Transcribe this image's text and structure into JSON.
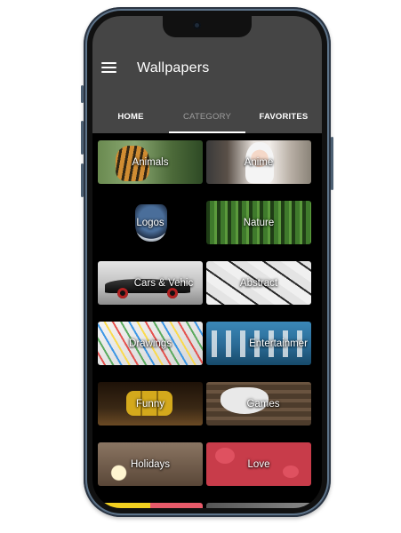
{
  "app": {
    "title": "Wallpapers"
  },
  "icons": {
    "menu": "menu-icon",
    "camera": "front-camera"
  },
  "tabs": [
    {
      "label": "HOME",
      "active": false
    },
    {
      "label": "CATEGORY",
      "active": true
    },
    {
      "label": "FAVORITES",
      "active": false
    }
  ],
  "categories": [
    {
      "label": "Animals",
      "bg": "#5d7a46"
    },
    {
      "label": "Anime",
      "bg": "#cfc6bd"
    },
    {
      "label": "Logos",
      "bg": "#000000"
    },
    {
      "label": "Nature",
      "bg": "#2f5a22"
    },
    {
      "label": "Cars & Vehic",
      "bg": "#c8c8c8"
    },
    {
      "label": "Abstract",
      "bg": "#e6e6e6"
    },
    {
      "label": "Drawings",
      "bg": "#d8d8d8"
    },
    {
      "label": "Entertainmer",
      "bg": "#2b6f96"
    },
    {
      "label": "Funny",
      "bg": "#3a2815"
    },
    {
      "label": "Games",
      "bg": "#5a4a3a"
    },
    {
      "label": "Holidays",
      "bg": "#6b5a4a"
    },
    {
      "label": "Love",
      "bg": "#c83c4a"
    }
  ],
  "colors": {
    "appbar": "#454545",
    "frame": "#5d7389",
    "background": "#000000"
  }
}
